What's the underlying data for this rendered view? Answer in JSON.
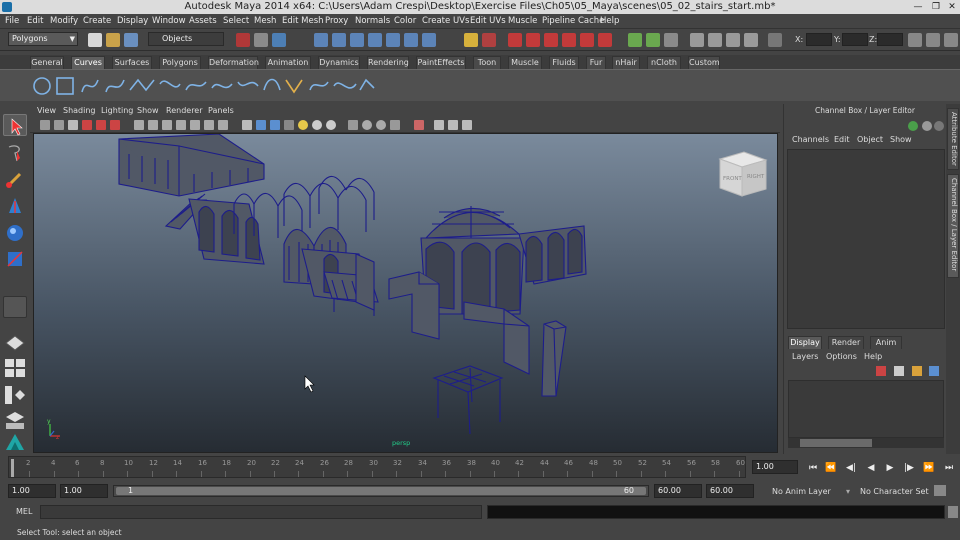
{
  "window": {
    "title": "Autodesk Maya 2014 x64: C:\\Users\\Adam Crespi\\Desktop\\Exercise Files\\Ch05\\05_Maya\\scenes\\05_02_stairs_start.mb*",
    "minimize": "—",
    "restore": "❐",
    "close": "✕"
  },
  "menubar": [
    "File",
    "Edit",
    "Modify",
    "Create",
    "Display",
    "Window",
    "Assets",
    "Select",
    "Mesh",
    "Edit Mesh",
    "Proxy",
    "Normals",
    "Color",
    "Create UVs",
    "Edit UVs",
    "Muscle",
    "Pipeline Cache",
    "Help"
  ],
  "statusline": {
    "menu_set": "Polygons",
    "selection_mode": "Objects",
    "x_label": "X:",
    "y_label": "Y:",
    "z_label": "Z:"
  },
  "shelf_tabs": [
    "General",
    "Curves",
    "Surfaces",
    "Polygons",
    "Deformation",
    "Animation",
    "Dynamics",
    "Rendering",
    "PaintEffects",
    "Toon",
    "Muscle",
    "Fluids",
    "Fur",
    "nHair",
    "nCloth",
    "Custom"
  ],
  "active_shelf": "Curves",
  "panel_menu": [
    "View",
    "Shading",
    "Lighting",
    "Show",
    "Renderer",
    "Panels"
  ],
  "viewport": {
    "view_cube_front": "FRONT",
    "view_cube_right": "RIGHT",
    "camera_label": "persp",
    "axis_y": "y",
    "axis_x": "x",
    "axis_z": "z"
  },
  "channel_box": {
    "title": "Channel Box / Layer Editor",
    "menu": [
      "Channels",
      "Edit",
      "Object",
      "Show"
    ],
    "layer_tabs": [
      "Display",
      "Render",
      "Anim"
    ],
    "active_layer_tab": "Display",
    "layer_menu": [
      "Layers",
      "Options",
      "Help"
    ]
  },
  "side_tabs": [
    "Attribute Editor",
    "Channel Box / Layer Editor"
  ],
  "timeline": {
    "ticks": [
      "2",
      "4",
      "6",
      "8",
      "10",
      "12",
      "14",
      "16",
      "18",
      "20",
      "22",
      "24",
      "26",
      "28",
      "30",
      "32",
      "34",
      "36",
      "38",
      "40",
      "42",
      "44",
      "46",
      "48",
      "50",
      "52",
      "54",
      "56",
      "58",
      "60"
    ],
    "current_time": "1.00"
  },
  "playback": [
    "⏮",
    "⏪",
    "◀|",
    "◀",
    "▶",
    "|▶",
    "⏩",
    "⏭"
  ],
  "range": {
    "start_time": "1.00",
    "playback_start": "1.00",
    "range_start_label": "1",
    "range_end_label": "60",
    "playback_end": "60.00",
    "end_time": "60.00",
    "anim_layer": "No Anim Layer",
    "char_set": "No Character Set"
  },
  "cmdline": {
    "label": "MEL"
  },
  "helpline": {
    "text": "Select Tool: select an object"
  },
  "colors": {
    "accent": "#5e5e5e",
    "wireframe": "#1d1d8a",
    "viewport_top": "#7a8a9c",
    "viewport_bottom": "#262c33"
  }
}
